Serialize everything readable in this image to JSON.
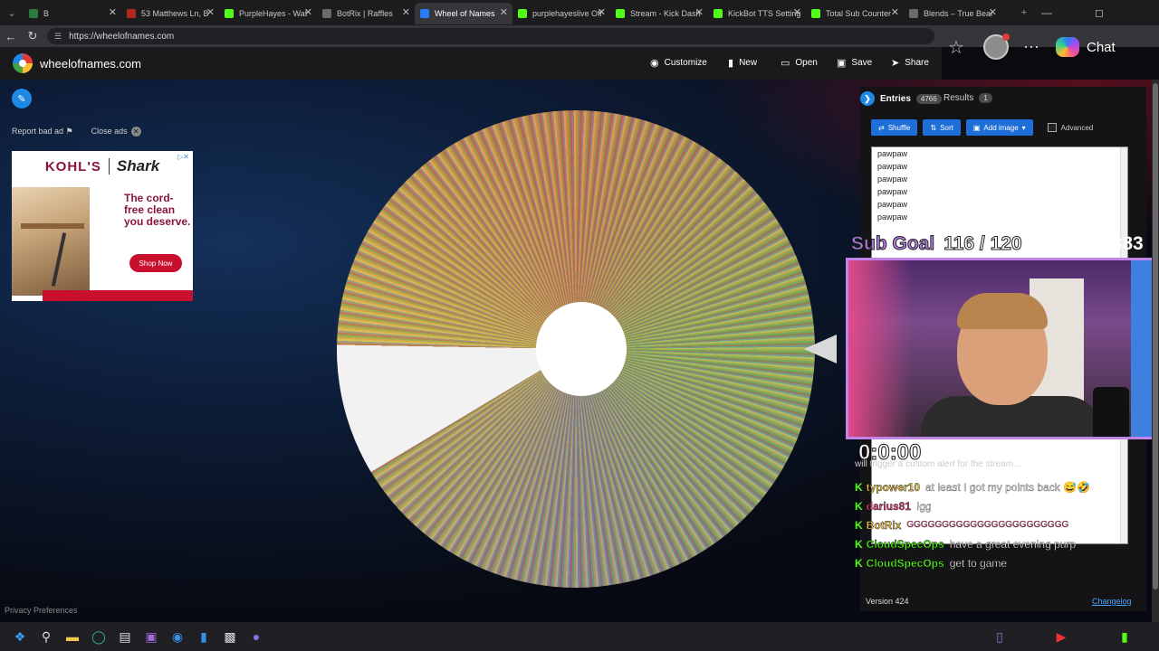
{
  "browser": {
    "tabs": [
      {
        "label": "B",
        "color": "#2b7a3f"
      },
      {
        "label": "53 Matthews Ln, B",
        "color": "#b3261e"
      },
      {
        "label": "PurpleHayes - Wat",
        "color": "#53fc18"
      },
      {
        "label": "BotRix | Raffles",
        "color": "#6b6b6b"
      },
      {
        "label": "Wheel of Names",
        "color": "#2b7df6",
        "active": true
      },
      {
        "label": "purplehayeslive Off",
        "color": "#53fc18"
      },
      {
        "label": "Stream - Kick Dash",
        "color": "#53fc18"
      },
      {
        "label": "KickBot TTS Setting",
        "color": "#53fc18"
      },
      {
        "label": "Total Sub Counter",
        "color": "#53fc18"
      },
      {
        "label": "Blends – True Bear",
        "color": "#6b6b6b"
      }
    ],
    "url": "https://wheelofnames.com",
    "chat_label": "Chat"
  },
  "site": {
    "title": "wheelofnames.com",
    "customize": "Customize",
    "new": "New",
    "open": "Open",
    "save": "Save",
    "share": "Share",
    "report_ad": "Report bad ad",
    "close_ads": "Close ads",
    "privacy": "Privacy Preferences"
  },
  "ad": {
    "brand1": "KOHL'S",
    "brand2": "Shark",
    "headline": "The cord-free clean you deserve.",
    "cta": "Shop Now"
  },
  "panel": {
    "entries_label": "Entries",
    "entries_count": "4766",
    "results_label": "Results",
    "results_count": "1",
    "shuffle": "Shuffle",
    "sort": "Sort",
    "add_image": "Add image",
    "advanced": "Advanced",
    "entries": [
      "pawpaw",
      "pawpaw",
      "pawpaw",
      "pawpaw",
      "pawpaw",
      "pawpaw"
    ],
    "version": "Version 424",
    "changelog": "Changelog"
  },
  "overlay": {
    "subgoal_label": "Sub Goal",
    "subgoal_value": "116 / 120",
    "sub_count": "1383",
    "timer": "0:0:00",
    "timer2": "0",
    "chat_top": "will trigger a custom alert for the stream...",
    "chat": [
      {
        "user": "typower10",
        "text": "at least I got my points back 😅🤣",
        "color": "#f2c94c"
      },
      {
        "user": "darius81",
        "text": "!gg",
        "color": "#e84a7a"
      },
      {
        "user": "BotRix",
        "text": "GGGGGGGGGGGGGGGGGGGGGGG",
        "color": "#f2c94c"
      },
      {
        "user": "CloudSpecOps",
        "text": "have a great evening purp",
        "color": "#53fc18"
      },
      {
        "user": "CloudSpecOps",
        "text": "get to game",
        "color": "#53fc18"
      }
    ]
  }
}
